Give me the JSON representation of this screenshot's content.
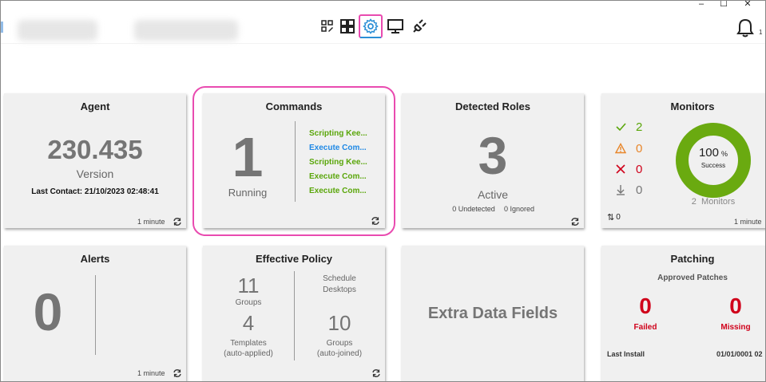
{
  "window_controls": {
    "minimize": "–",
    "maximize": "☐",
    "close": "✕"
  },
  "toolbar": {
    "icons": [
      "edit-grid-icon",
      "dashboard-grid-icon",
      "settings-gear-icon",
      "monitor-icon",
      "plug-icon"
    ],
    "notifications_count": "1"
  },
  "cards": {
    "agent": {
      "title": "Agent",
      "version_value": "230.435",
      "version_label": "Version",
      "last_contact": "Last Contact: 21/10/2023 02:48:41",
      "interval": "1 minute"
    },
    "commands": {
      "title": "Commands",
      "running_count": "1",
      "running_label": "Running",
      "items": [
        {
          "label": "Scripting Kee...",
          "color": "#5aa60a"
        },
        {
          "label": "Execute Com...",
          "color": "#1e88e5"
        },
        {
          "label": "Scripting Kee...",
          "color": "#5aa60a"
        },
        {
          "label": "Execute Com...",
          "color": "#5aa60a"
        },
        {
          "label": "Execute Com...",
          "color": "#5aa60a"
        }
      ]
    },
    "detected_roles": {
      "title": "Detected Roles",
      "count": "3",
      "label": "Active",
      "undetected": "0 Undetected",
      "ignored": "0 Ignored"
    },
    "monitors": {
      "title": "Monitors",
      "rows": [
        {
          "icon": "check-icon",
          "value": "2",
          "color": "#5aa60a"
        },
        {
          "icon": "warning-icon",
          "value": "0",
          "color": "#e8862a"
        },
        {
          "icon": "cross-icon",
          "value": "0",
          "color": "#d0021b"
        },
        {
          "icon": "down-arrow-icon",
          "value": "0",
          "color": "#777777"
        }
      ],
      "donut_value": "100",
      "donut_unit": "%",
      "donut_label": "Success",
      "donut_fraction": 1.0,
      "monitors_count": "2",
      "monitors_label": "Monitors",
      "sort_value": "0",
      "interval": "1 minute"
    },
    "alerts": {
      "title": "Alerts",
      "count": "0",
      "interval": "1 minute"
    },
    "effective_policy": {
      "title": "Effective Policy",
      "groups_count": "11",
      "groups_label": "Groups",
      "templates_count": "4",
      "templates_label1": "Templates",
      "templates_label2": "(auto-applied)",
      "schedule_label1": "Schedule",
      "schedule_label2": "Desktops",
      "auto_groups_count": "10",
      "auto_groups_label1": "Groups",
      "auto_groups_label2": "(auto-joined)"
    },
    "extra_data": {
      "title": "Extra Data Fields"
    },
    "patching": {
      "title": "Patching",
      "subtitle": "Approved Patches",
      "failed_count": "0",
      "failed_label": "Failed",
      "missing_count": "0",
      "missing_label": "Missing",
      "last_install_label": "Last Install",
      "last_install_value": "01/01/0001 02"
    }
  }
}
